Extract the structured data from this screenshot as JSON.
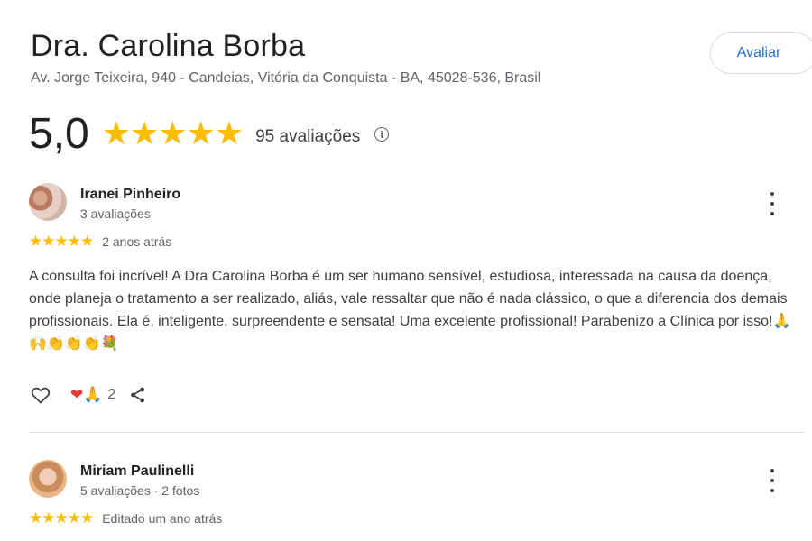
{
  "place": {
    "name": "Dra. Carolina Borba",
    "address": "Av. Jorge Teixeira, 940 - Candeias, Vitória da Conquista - BA, 45028-536, Brasil",
    "rate_button_label": "Avaliar"
  },
  "summary": {
    "score": "5,0",
    "stars": "★★★★★",
    "rating_value": 5,
    "rating_max": 5,
    "review_count": "95 avaliações",
    "info_icon": "info-icon"
  },
  "reviews": [
    {
      "name": "Iranei Pinheiro",
      "meta": "3 avaliações",
      "stars": "★★★★★",
      "rating_value": 5,
      "date": "2 anos atrás",
      "text": "A consulta foi incrível! A Dra Carolina Borba é um ser humano sensível, estudiosa, interessada na causa da doença, onde planeja o tratamento a ser realizado, aliás, vale ressaltar que não é nada clássico, o que a diferencia dos demais profissionais. Ela é, inteligente, surpreendente e sensata! Uma excelente profissional! Parabenizo a Clínica por isso!🙏🙌👏👏👏💐",
      "reactions": {
        "heart": "❤",
        "pray": "🙏",
        "count": "2"
      },
      "icons": {
        "like": "heart-outline-icon",
        "share": "share-icon",
        "more": "more-vert-icon"
      }
    },
    {
      "name": "Miriam Paulinelli",
      "meta": "5 avaliações · 2 fotos",
      "stars": "★★★★★",
      "rating_value": 5,
      "date": "Editado um ano atrás",
      "icons": {
        "more": "more-vert-icon"
      }
    }
  ],
  "colors": {
    "star": "#fbbc04",
    "link_blue": "#1a73e8",
    "text_primary": "#202124",
    "text_secondary": "#5f6368"
  }
}
